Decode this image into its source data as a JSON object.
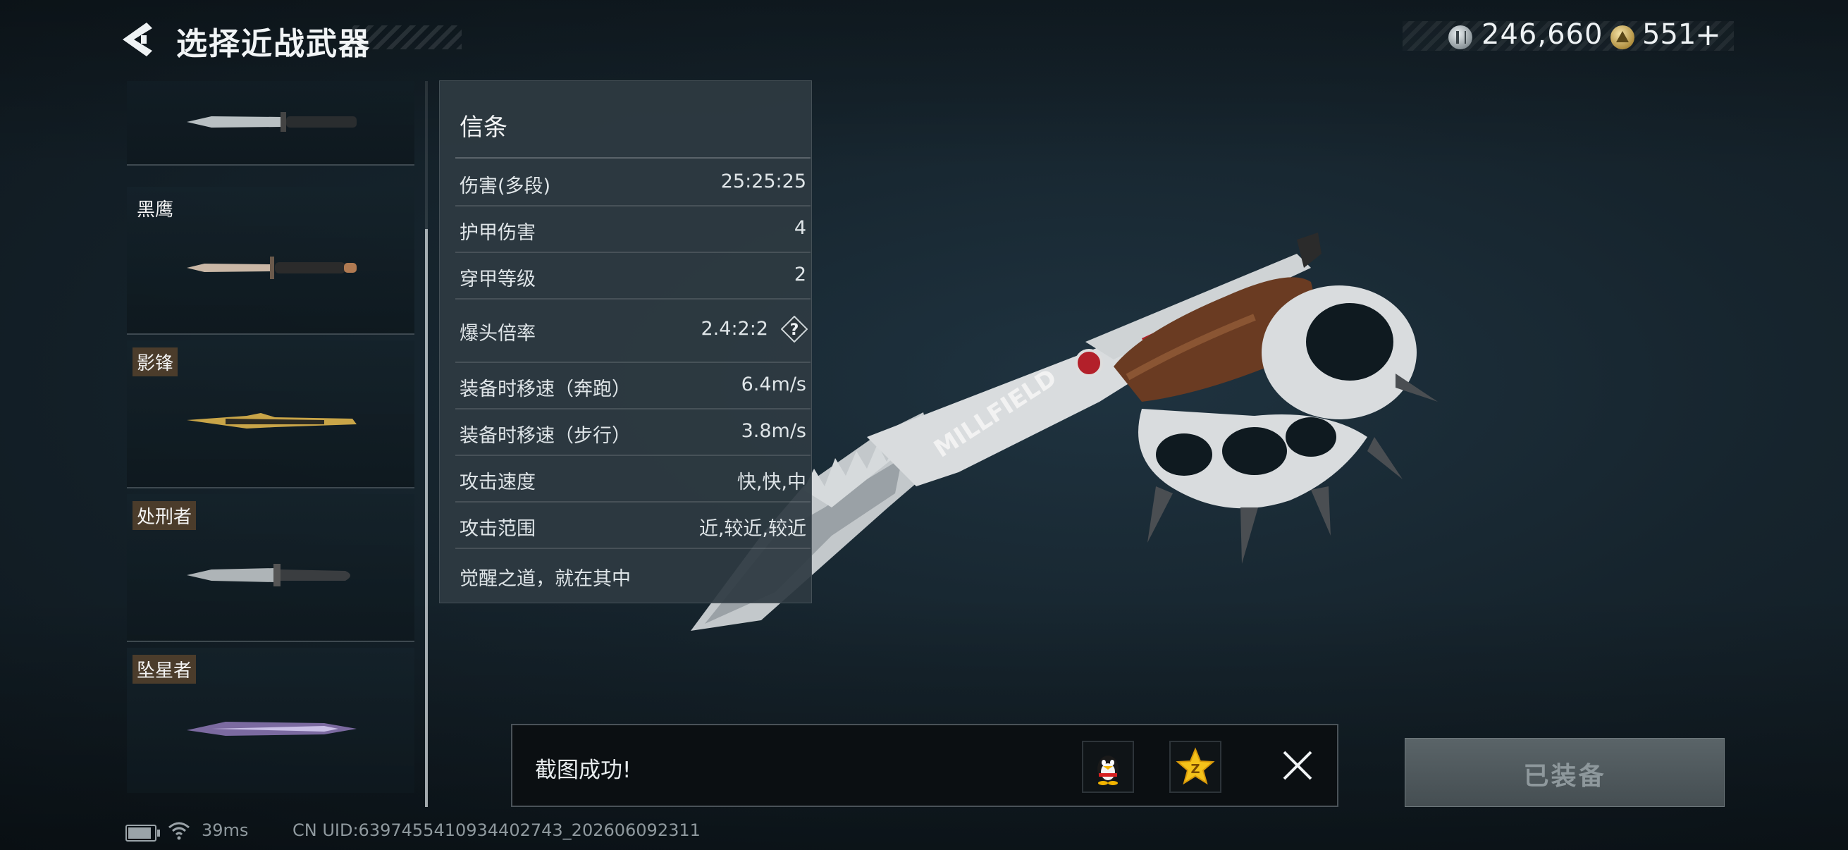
{
  "header": {
    "title": "选择近战武器",
    "back_icon": "back-arrow-icon"
  },
  "currency": {
    "silver_icon": "silver-coin-icon",
    "silver_amount": "246,660",
    "gold_icon": "gold-coin-icon",
    "gold_amount": "551",
    "add_label": "+"
  },
  "weapon_list": {
    "items": [
      {
        "name": "",
        "image": "combat-knife-icon"
      },
      {
        "name": "黑鹰",
        "image": "black-eagle-knife-icon"
      },
      {
        "name": "影锋",
        "image": "shadow-blade-knife-icon"
      },
      {
        "name": "处刑者",
        "image": "executioner-knife-icon"
      },
      {
        "name": "坠星者",
        "image": "star-faller-blade-icon"
      }
    ]
  },
  "stats": {
    "title": "信条",
    "rows": [
      {
        "label": "伤害(多段)",
        "value": "25:25:25"
      },
      {
        "label": "护甲伤害",
        "value": "4"
      },
      {
        "label": "穿甲等级",
        "value": "2"
      },
      {
        "label": "爆头倍率",
        "value": "2.4:2:2"
      },
      {
        "label": "装备时移速（奔跑）",
        "value": "6.4m/s"
      },
      {
        "label": "装备时移速（步行）",
        "value": "3.8m/s"
      },
      {
        "label": "攻击速度",
        "value": "快,快,中"
      },
      {
        "label": "攻击范围",
        "value": "近,较近,较近"
      }
    ],
    "help_label": "?",
    "description": "觉醒之道，就在其中"
  },
  "preview": {
    "engraving": "MILLFIELD"
  },
  "toast": {
    "message": "截图成功!",
    "share_qq_icon": "qq-penguin-icon",
    "share_qzone_icon": "qzone-star-icon",
    "qzone_badge": "Z",
    "close_icon": "close-icon"
  },
  "equip_button": {
    "label": "已装备"
  },
  "footer": {
    "ping": "39ms",
    "uid": "CN UID:6397455410934402743_202606092311"
  },
  "colors": {
    "background": "#16242d",
    "panel": "#2e3a42",
    "accent_red": "#b3202a",
    "tag_brown": "#4b3c2b"
  }
}
